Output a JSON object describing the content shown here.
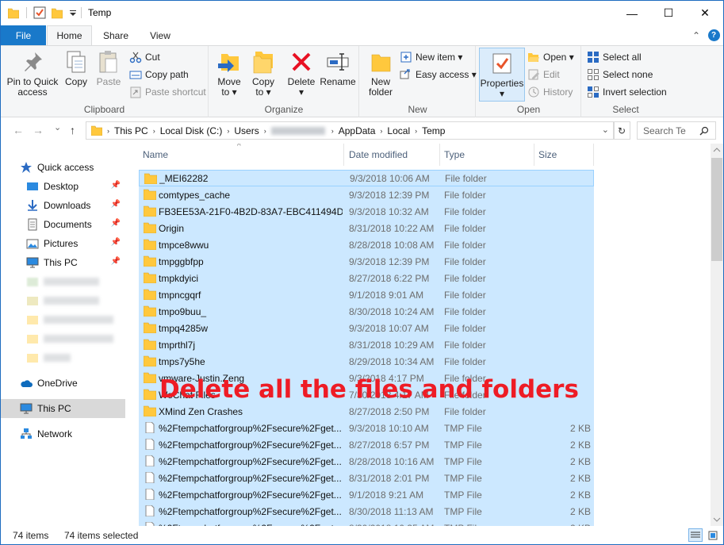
{
  "window": {
    "title": "Temp",
    "minimize_glyph": "—",
    "maximize_glyph": "☐",
    "close_glyph": "✕"
  },
  "tabs": {
    "file": "File",
    "home": "Home",
    "share": "Share",
    "view": "View",
    "collapse_glyph": "⌃",
    "help_glyph": "?"
  },
  "ribbon": {
    "clipboard": {
      "label": "Clipboard",
      "pin_line1": "Pin to Quick",
      "pin_line2": "access",
      "copy": "Copy",
      "paste": "Paste",
      "cut": "Cut",
      "copy_path": "Copy path",
      "paste_shortcut": "Paste shortcut"
    },
    "organize": {
      "label": "Organize",
      "move_to_line1": "Move",
      "move_to_line2": "to ▾",
      "copy_to_line1": "Copy",
      "copy_to_line2": "to ▾",
      "delete_line1": "Delete",
      "delete_line2": "▾",
      "rename": "Rename"
    },
    "new": {
      "label": "New",
      "new_folder_line1": "New",
      "new_folder_line2": "folder",
      "new_item": "New item ▾",
      "easy_access": "Easy access ▾"
    },
    "open": {
      "label": "Open",
      "properties_line1": "Properties",
      "properties_line2": "▾",
      "open": "Open ▾",
      "edit": "Edit",
      "history": "History"
    },
    "select": {
      "label": "Select",
      "select_all": "Select all",
      "select_none": "Select none",
      "invert_selection": "Invert selection"
    }
  },
  "address": {
    "back_glyph": "←",
    "forward_glyph": "→",
    "recent_glyph": "⌄",
    "up_glyph": "↑",
    "crumbs": [
      "This PC",
      "Local Disk (C:)",
      "Users",
      "AppData",
      "Local",
      "Temp"
    ],
    "separator": "›",
    "dropdown_glyph": "⌄",
    "refresh_glyph": "↻",
    "search_placeholder": "Search Te"
  },
  "nav": {
    "quick_access": "Quick access",
    "desktop": "Desktop",
    "downloads": "Downloads",
    "documents": "Documents",
    "pictures": "Pictures",
    "this_pc_pinned": "This PC",
    "onedrive": "OneDrive",
    "this_pc": "This PC",
    "network": "Network",
    "pin_glyph": "📌"
  },
  "columns": {
    "name": "Name",
    "date_modified": "Date modified",
    "type": "Type",
    "size": "Size",
    "sort_glyph": "^"
  },
  "files": [
    {
      "name": "_MEI62282",
      "date": "9/3/2018 10:06 AM",
      "type": "File folder",
      "size": ""
    },
    {
      "name": "comtypes_cache",
      "date": "9/3/2018 12:39 PM",
      "type": "File folder",
      "size": ""
    },
    {
      "name": "FB3EE53A-21F0-4B2D-83A7-EBC411494D29",
      "date": "9/3/2018 10:32 AM",
      "type": "File folder",
      "size": ""
    },
    {
      "name": "Origin",
      "date": "8/31/2018 10:22 AM",
      "type": "File folder",
      "size": ""
    },
    {
      "name": "tmpce8wwu",
      "date": "8/28/2018 10:08 AM",
      "type": "File folder",
      "size": ""
    },
    {
      "name": "tmpggbfpp",
      "date": "9/3/2018 12:39 PM",
      "type": "File folder",
      "size": ""
    },
    {
      "name": "tmpkdyici",
      "date": "8/27/2018 6:22 PM",
      "type": "File folder",
      "size": ""
    },
    {
      "name": "tmpncgqrf",
      "date": "9/1/2018 9:01 AM",
      "type": "File folder",
      "size": ""
    },
    {
      "name": "tmpo9buu_",
      "date": "8/30/2018 10:24 AM",
      "type": "File folder",
      "size": ""
    },
    {
      "name": "tmpq4285w",
      "date": "9/3/2018 10:07 AM",
      "type": "File folder",
      "size": ""
    },
    {
      "name": "tmprthl7j",
      "date": "8/31/2018 10:29 AM",
      "type": "File folder",
      "size": ""
    },
    {
      "name": "tmps7y5he",
      "date": "8/29/2018 10:34 AM",
      "type": "File folder",
      "size": ""
    },
    {
      "name": "vmware-Justin.Zeng",
      "date": "9/3/2018 4:17 PM",
      "type": "File folder",
      "size": ""
    },
    {
      "name": "WeChat Files",
      "date": "7/30/2018 4:17 AM",
      "type": "File folder",
      "size": ""
    },
    {
      "name": "XMind Zen Crashes",
      "date": "8/27/2018 2:50 PM",
      "type": "File folder",
      "size": ""
    },
    {
      "name": "%2Ftempchatforgroup%2Fsecure%2Fget...",
      "date": "9/3/2018 10:10 AM",
      "type": "TMP File",
      "size": "2 KB"
    },
    {
      "name": "%2Ftempchatforgroup%2Fsecure%2Fget...",
      "date": "8/27/2018 6:57 PM",
      "type": "TMP File",
      "size": "2 KB"
    },
    {
      "name": "%2Ftempchatforgroup%2Fsecure%2Fget...",
      "date": "8/28/2018 10:16 AM",
      "type": "TMP File",
      "size": "2 KB"
    },
    {
      "name": "%2Ftempchatforgroup%2Fsecure%2Fget...",
      "date": "8/31/2018 2:01 PM",
      "type": "TMP File",
      "size": "2 KB"
    },
    {
      "name": "%2Ftempchatforgroup%2Fsecure%2Fget...",
      "date": "9/1/2018 9:21 AM",
      "type": "TMP File",
      "size": "2 KB"
    },
    {
      "name": "%2Ftempchatforgroup%2Fsecure%2Fget...",
      "date": "8/30/2018 11:13 AM",
      "type": "TMP File",
      "size": "2 KB"
    },
    {
      "name": "%2Ftempchatforgroup%2Fsecure%2Fget...",
      "date": "8/30/2018 10:35 AM",
      "type": "TMP File",
      "size": "2 KB"
    }
  ],
  "overlay_text": "Delete all the files and folders",
  "status": {
    "item_count": "74 items",
    "selected": "74 items selected"
  },
  "colors": {
    "accent": "#1979ca",
    "selection": "#cce8ff",
    "overlay": "#ee1c25",
    "folder": "#ffc83d"
  }
}
